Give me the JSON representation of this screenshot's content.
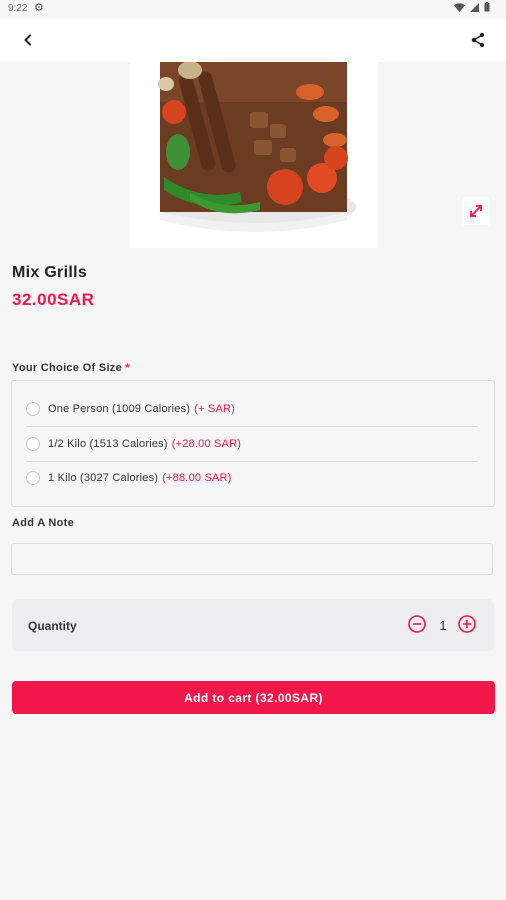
{
  "status_bar": {
    "time": "9:22"
  },
  "product": {
    "name": "Mix Grills",
    "price": "32.00SAR"
  },
  "size_section": {
    "title": "Your Choice Of Size",
    "required_marker": "*",
    "options": [
      {
        "label": "One Person (1009 Calories)",
        "extra": "(+ SAR)"
      },
      {
        "label": "1/2 Kilo (1513 Calories)",
        "extra": "(+28.00 SAR)"
      },
      {
        "label": "1 Kilo (3027 Calories)",
        "extra": "(+88.00 SAR)"
      }
    ]
  },
  "note_section": {
    "title": "Add A Note",
    "placeholder": ""
  },
  "quantity": {
    "label": "Quantity",
    "value": "1"
  },
  "cart_button": {
    "label": "Add to cart (32.00SAR)"
  },
  "colors": {
    "accent": "#f2174a",
    "background": "#f6f6f6"
  }
}
